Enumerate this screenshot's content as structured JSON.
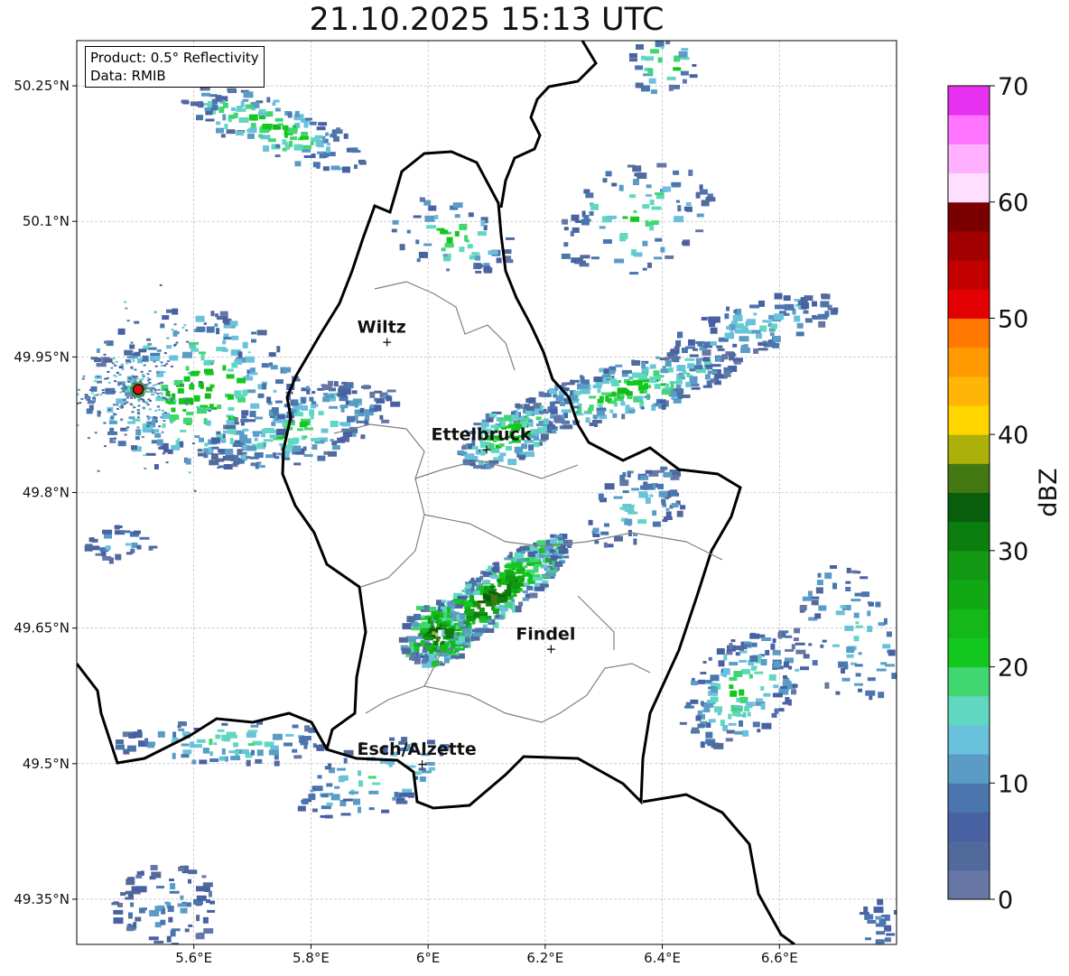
{
  "title": "21.10.2025 15:13 UTC",
  "info": {
    "product": "Product: 0.5° Reflectivity",
    "data": "Data: RMIB"
  },
  "map": {
    "lon_range": [
      5.4,
      6.8
    ],
    "lat_range": [
      49.3,
      50.3
    ],
    "lon_ticks": [
      "5.6°E",
      "5.8°E",
      "6°E",
      "6.2°E",
      "6.4°E",
      "6.6°E"
    ],
    "lon_tick_values": [
      5.6,
      5.8,
      6.0,
      6.2,
      6.4,
      6.6
    ],
    "lat_ticks": [
      "49.35°N",
      "49.5°N",
      "49.65°N",
      "49.8°N",
      "49.95°N",
      "50.1°N",
      "50.25°N"
    ],
    "lat_tick_values": [
      49.35,
      49.5,
      49.65,
      49.8,
      49.95,
      50.1,
      50.25
    ],
    "gridlines": true,
    "cities": [
      {
        "name": "Wiltz",
        "lon": 5.93,
        "lat": 49.967
      },
      {
        "name": "Ettelbruck",
        "lon": 6.1,
        "lat": 49.848
      },
      {
        "name": "Findel",
        "lon": 6.21,
        "lat": 49.627
      },
      {
        "name": "Esch/Alzette",
        "lon": 5.99,
        "lat": 49.5
      }
    ],
    "radar_site": {
      "lon": 5.505,
      "lat": 49.914
    }
  },
  "colorbar": {
    "label": "dBZ",
    "min": 0,
    "max": 70,
    "ticks": [
      "0",
      "10",
      "20",
      "30",
      "40",
      "50",
      "60",
      "70"
    ],
    "colors": [
      "#6677a6",
      "#52699b",
      "#4861a3",
      "#4a75ad",
      "#5a9cc5",
      "#6ac1dc",
      "#60d7c0",
      "#40d670",
      "#12c81e",
      "#14b818",
      "#12a814",
      "#129812",
      "#0c7e10",
      "#095e0b",
      "#447813",
      "#acb009",
      "#ffd500",
      "#ffb505",
      "#ff9900",
      "#ff7800",
      "#e30000",
      "#c20000",
      "#a20000",
      "#7a0000",
      "#ffdfff",
      "#ffb0ff",
      "#ff75ff",
      "#e632f0"
    ]
  }
}
